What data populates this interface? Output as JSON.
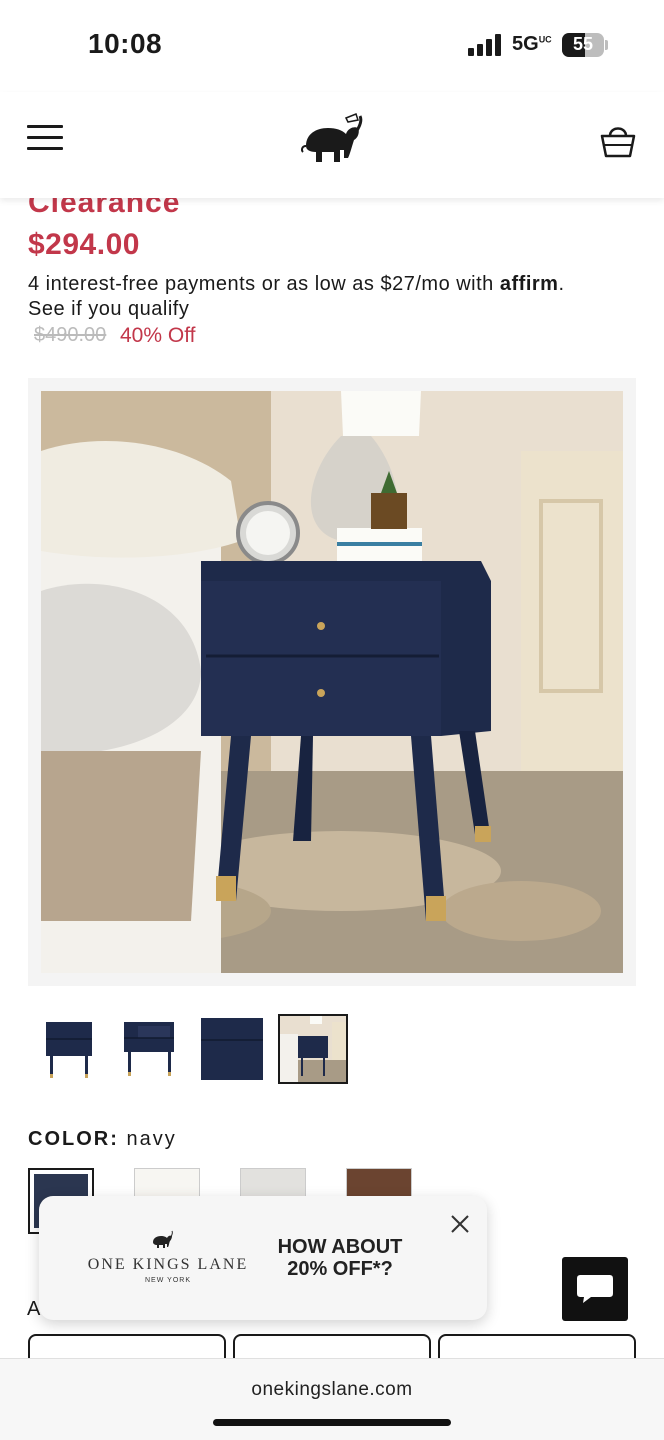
{
  "status_bar": {
    "time": "10:08",
    "network": "5G",
    "network_suffix": "UC",
    "battery": "55",
    "battery_level_percent": 55
  },
  "header": {
    "menu_icon": "hamburger-icon",
    "logo_icon": "elephant-logo-icon",
    "cart_icon": "shopping-bag-icon"
  },
  "product": {
    "clearance_label": "Clearance",
    "price": "$294.00",
    "financing_text": "4 interest-free payments or as low as $27/mo with",
    "financing_brand": "affirm",
    "financing_end": ".",
    "qualify_link": "See if you qualify",
    "original_price": "$490.00",
    "discount": "40% Off"
  },
  "gallery": {
    "selected_index": 3,
    "thumb_count": 4
  },
  "color": {
    "label": "COLOR:",
    "value": "navy",
    "swatches": [
      "#2b3650",
      "#f7f6f2",
      "#e2e1de",
      "#6b4430"
    ],
    "selected_index": 0
  },
  "promo": {
    "brand": "ONE KINGS LANE",
    "sub": "NEW YORK",
    "headline": "HOW ABOUT 20% OFF*?"
  },
  "below": {
    "partial_label": "A"
  },
  "browser": {
    "url": "onekingslane.com"
  },
  "colors": {
    "accent": "#c2374a",
    "navy": "#1e2a4a"
  }
}
